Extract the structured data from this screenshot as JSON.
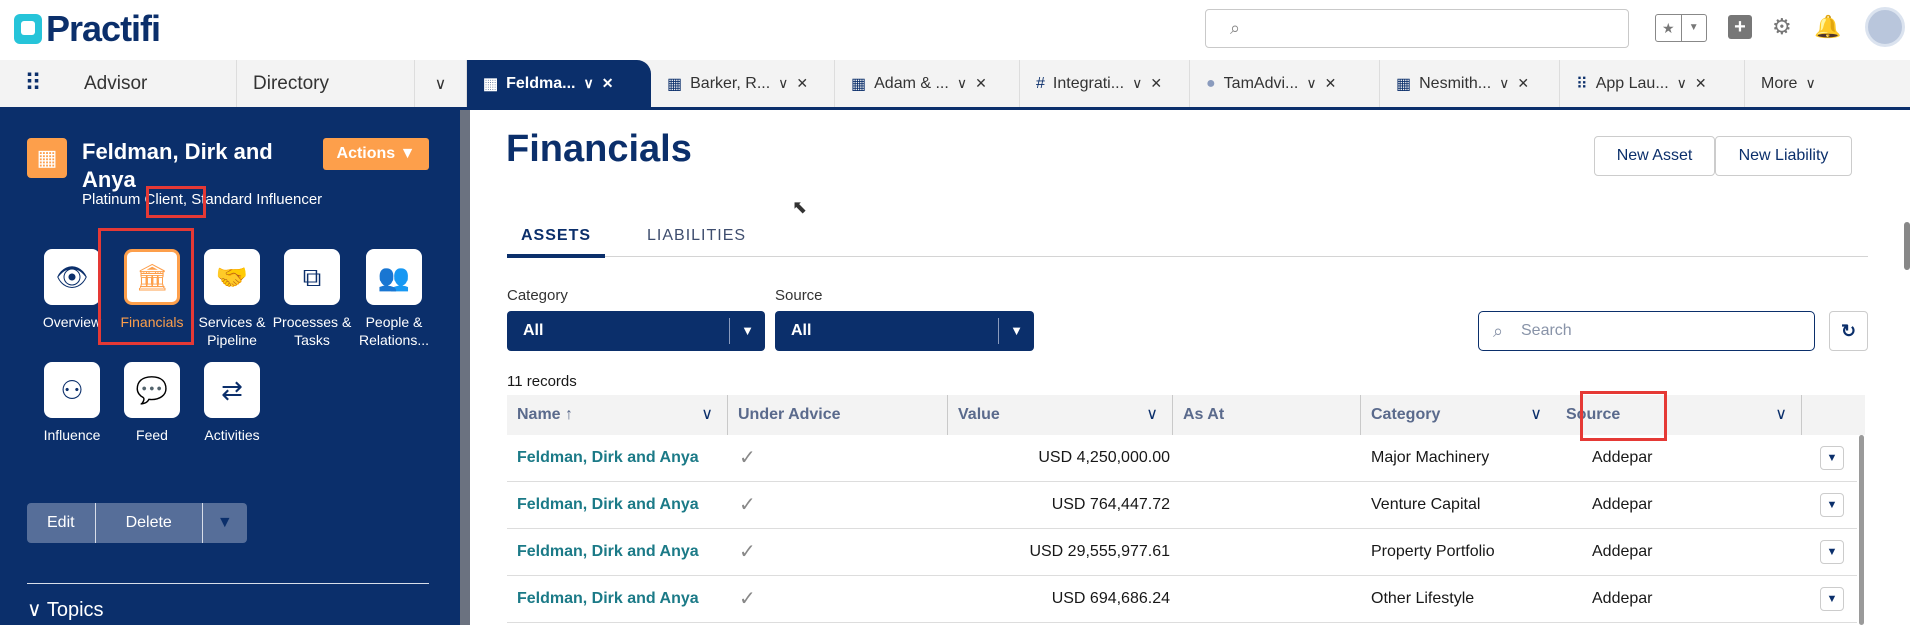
{
  "header": {
    "logo": "Practifi",
    "search_placeholder": "",
    "icons": [
      "search-icon",
      "favorites-star-icon",
      "add-icon",
      "setup-gear-icon",
      "notifications-bell-icon",
      "avatar"
    ]
  },
  "nav": {
    "app_name": "Advisor",
    "directory": "Directory",
    "tabs": [
      {
        "label": "Feldma...",
        "icon": "building",
        "active": true
      },
      {
        "label": "Barker, R...",
        "icon": "building"
      },
      {
        "label": "Adam & ...",
        "icon": "building"
      },
      {
        "label": "Integrati...",
        "icon": "integration"
      },
      {
        "label": "TamAdvi...",
        "icon": "cloud"
      },
      {
        "label": "Nesmith...",
        "icon": "building"
      },
      {
        "label": "App Lau...",
        "icon": "app-grid"
      }
    ],
    "more": "More"
  },
  "sidebar": {
    "name": "Feldman, Dirk and Anya",
    "actions": "Actions",
    "subtitle_before": "Platinum",
    "subtitle_highlight": "Client,",
    "subtitle_after": "Standard Influencer",
    "tiles": [
      {
        "label": "Overview",
        "icon": "eye"
      },
      {
        "label": "Financials",
        "icon": "bank",
        "selected": true
      },
      {
        "label": "Services & Pipeline",
        "icon": "handshake"
      },
      {
        "label": "Processes & Tasks",
        "icon": "hierarchy"
      },
      {
        "label": "People & Relations...",
        "icon": "people"
      },
      {
        "label": "Influence",
        "icon": "binoculars"
      },
      {
        "label": "Feed",
        "icon": "chat"
      },
      {
        "label": "Activities",
        "icon": "arrows"
      }
    ],
    "edit": "Edit",
    "delete": "Delete",
    "topics": "Topics"
  },
  "main": {
    "title": "Financials",
    "new_asset": "New Asset",
    "new_liability": "New Liability",
    "tabs": [
      "ASSETS",
      "LIABILITIES"
    ],
    "filters": {
      "category_label": "Category",
      "category_value": "All",
      "source_label": "Source",
      "source_value": "All"
    },
    "search_placeholder": "Search",
    "records": "11 records",
    "columns": [
      "Name",
      "Under Advice",
      "Value",
      "As At",
      "Category",
      "Source"
    ],
    "rows": [
      {
        "name": "Feldman, Dirk and Anya",
        "under_advice": "✓",
        "value": "USD 4,250,000.00",
        "as_at": "",
        "category": "Major Machinery",
        "source": "Addepar"
      },
      {
        "name": "Feldman, Dirk and Anya",
        "under_advice": "✓",
        "value": "USD 764,447.72",
        "as_at": "",
        "category": "Venture Capital",
        "source": "Addepar"
      },
      {
        "name": "Feldman, Dirk and Anya",
        "under_advice": "✓",
        "value": "USD 29,555,977.61",
        "as_at": "",
        "category": "Property Portfolio",
        "source": "Addepar"
      },
      {
        "name": "Feldman, Dirk and Anya",
        "under_advice": "✓",
        "value": "USD 694,686.24",
        "as_at": "",
        "category": "Other Lifestyle",
        "source": "Addepar"
      }
    ]
  },
  "colors": {
    "navy": "#0b2f6b",
    "orange": "#fd9f4b",
    "link": "#1b7a87",
    "highlight": "#e53935"
  }
}
